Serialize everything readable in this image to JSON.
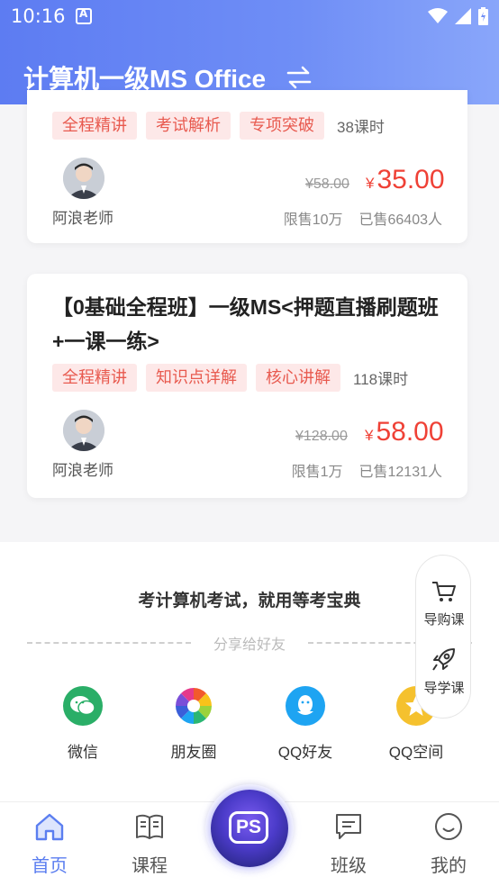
{
  "status_bar": {
    "time": "10:16"
  },
  "header": {
    "title": "计算机一级MS Office"
  },
  "courses": [
    {
      "tags": [
        "全程精讲",
        "考试解析",
        "专项突破"
      ],
      "lessons": "38课时",
      "teacher": "阿浪老师",
      "old_price": "¥58.00",
      "currency": "¥",
      "price": "35.00",
      "limit": "限售10万",
      "sold": "已售66403人"
    },
    {
      "title": "【0基础全程班】一级MS<押题直播刷题班+一课一练>",
      "tags": [
        "全程精讲",
        "知识点详解",
        "核心讲解"
      ],
      "lessons": "118课时",
      "teacher": "阿浪老师",
      "old_price": "¥128.00",
      "currency": "¥",
      "price": "58.00",
      "limit": "限售1万",
      "sold": "已售12131人"
    }
  ],
  "share": {
    "slogan": "考计算机考试，就用等考宝典",
    "divider_label": "分享给好友",
    "items": [
      {
        "label": "微信",
        "icon": "wechat-icon",
        "color": "#2aae67"
      },
      {
        "label": "朋友圈",
        "icon": "moments-icon",
        "color": "#ffffff"
      },
      {
        "label": "QQ好友",
        "icon": "qq-icon",
        "color": "#1ea4f2"
      },
      {
        "label": "QQ空间",
        "icon": "qzone-icon",
        "color": "#f5c12e"
      }
    ]
  },
  "float_panel": {
    "cart_label": "导购课",
    "guide_label": "导学课"
  },
  "tabbar": {
    "items": [
      {
        "label": "首页",
        "icon": "home-icon",
        "active": true
      },
      {
        "label": "课程",
        "icon": "book-icon",
        "active": false
      },
      {
        "label": "班级",
        "icon": "chat-icon",
        "active": false
      },
      {
        "label": "我的",
        "icon": "smile-icon",
        "active": false
      }
    ],
    "center_label": "PS"
  },
  "colors": {
    "accent": "#5b7ef0",
    "price": "#ef4136",
    "tag_bg": "#fde8e8",
    "tag_text": "#e85a4f"
  }
}
